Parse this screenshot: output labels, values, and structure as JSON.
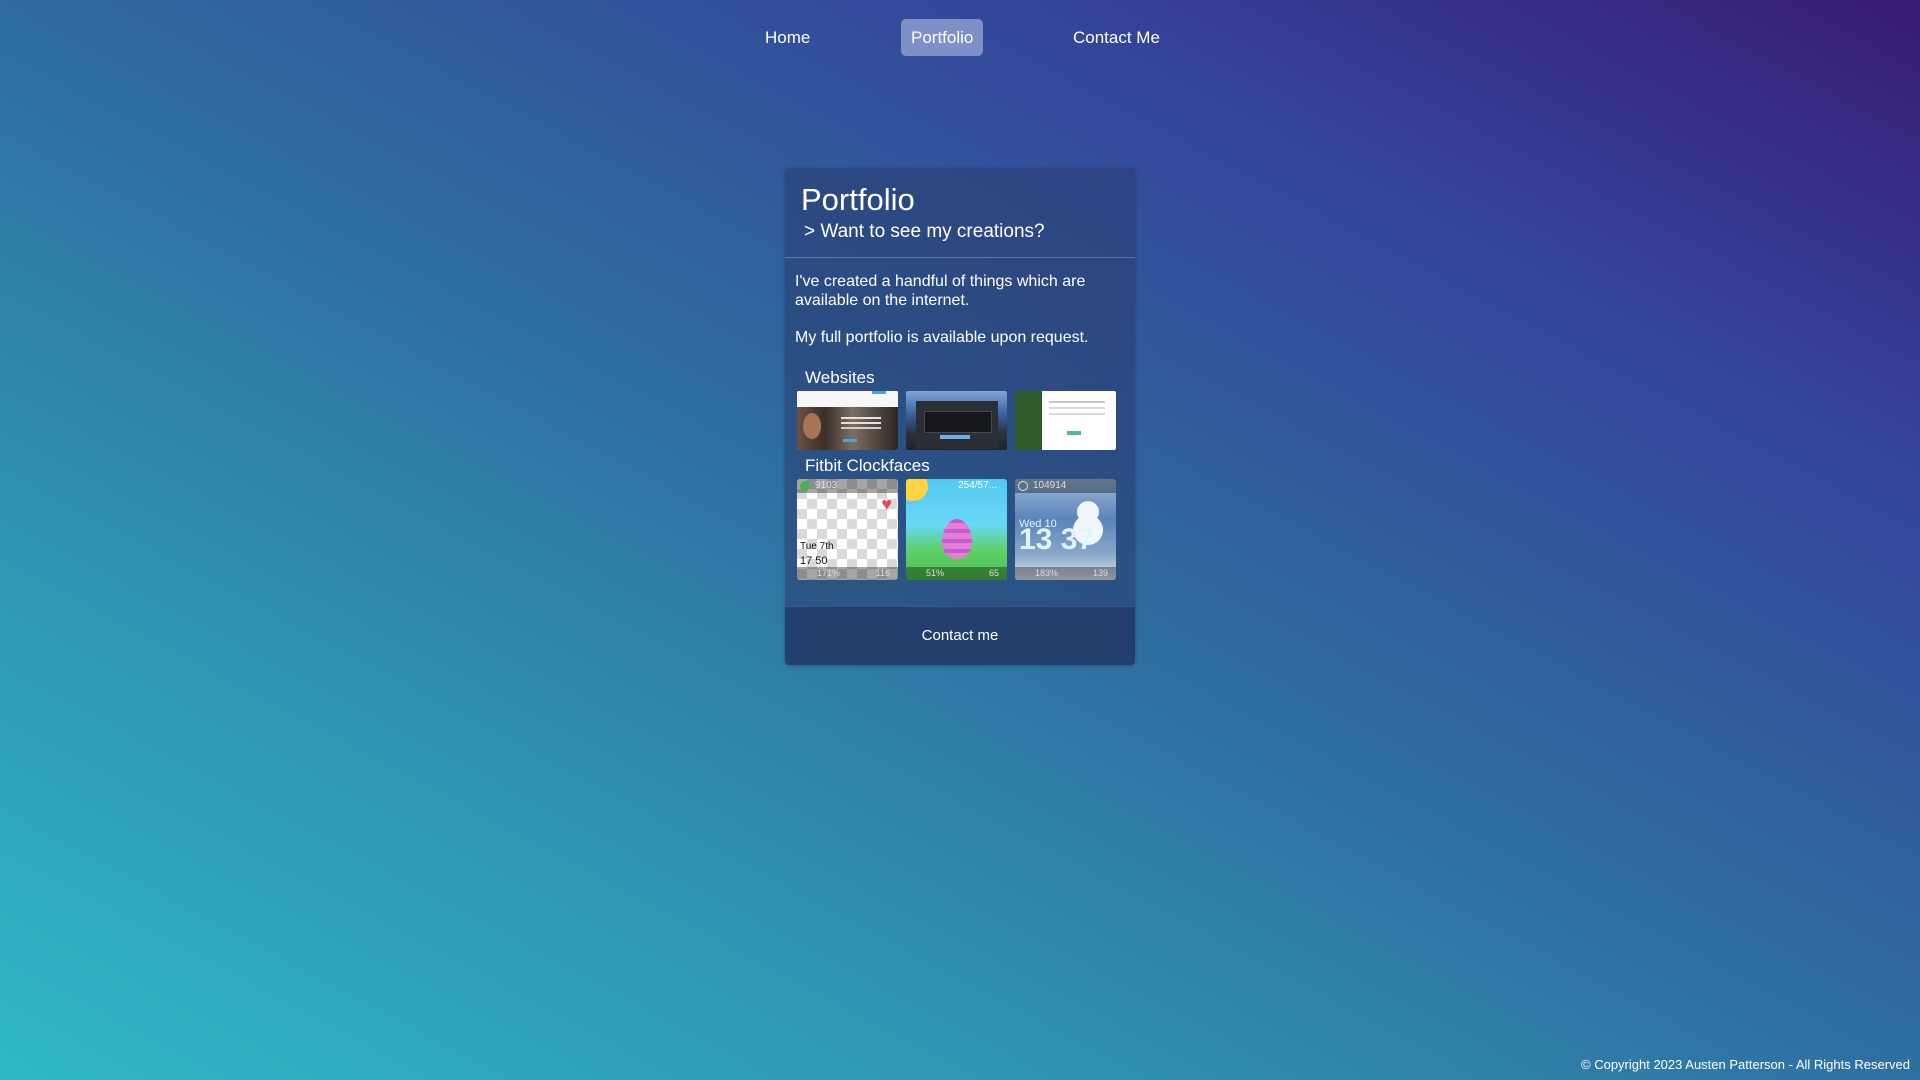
{
  "nav": {
    "items": [
      {
        "label": "Home",
        "active": false
      },
      {
        "label": "Portfolio",
        "active": true
      },
      {
        "label": "Contact Me",
        "active": false
      }
    ]
  },
  "card": {
    "title": "Portfolio",
    "subtitle": "> Want to see my creations?",
    "paragraph1": "I've created a handful of things which are available on the internet.",
    "paragraph2": "My full portfolio is available upon request.",
    "websites_label": "Websites",
    "clockfaces_label": "Fitbit Clockfaces",
    "footer_link": "Contact me"
  },
  "clockfaces": [
    {
      "top_stat": "9103",
      "date": "Tue 7th",
      "time": "17 50",
      "battery": "171%",
      "heart": "116"
    },
    {
      "top_stat": "254/57...",
      "battery": "51%",
      "heart": "65"
    },
    {
      "top_stat": "104914",
      "date": "Wed 10",
      "time": "13 37",
      "battery": "183%",
      "heart": "139"
    }
  ],
  "footer": {
    "copyright": "© Copyright 2023 Austen Patterson - All Rights Reserved"
  },
  "colors": {
    "gradient_start": "#2fb9c6",
    "gradient_end": "#391b74",
    "nav_active_bg": "#8e9bc9",
    "heart": "#e04a5a"
  }
}
